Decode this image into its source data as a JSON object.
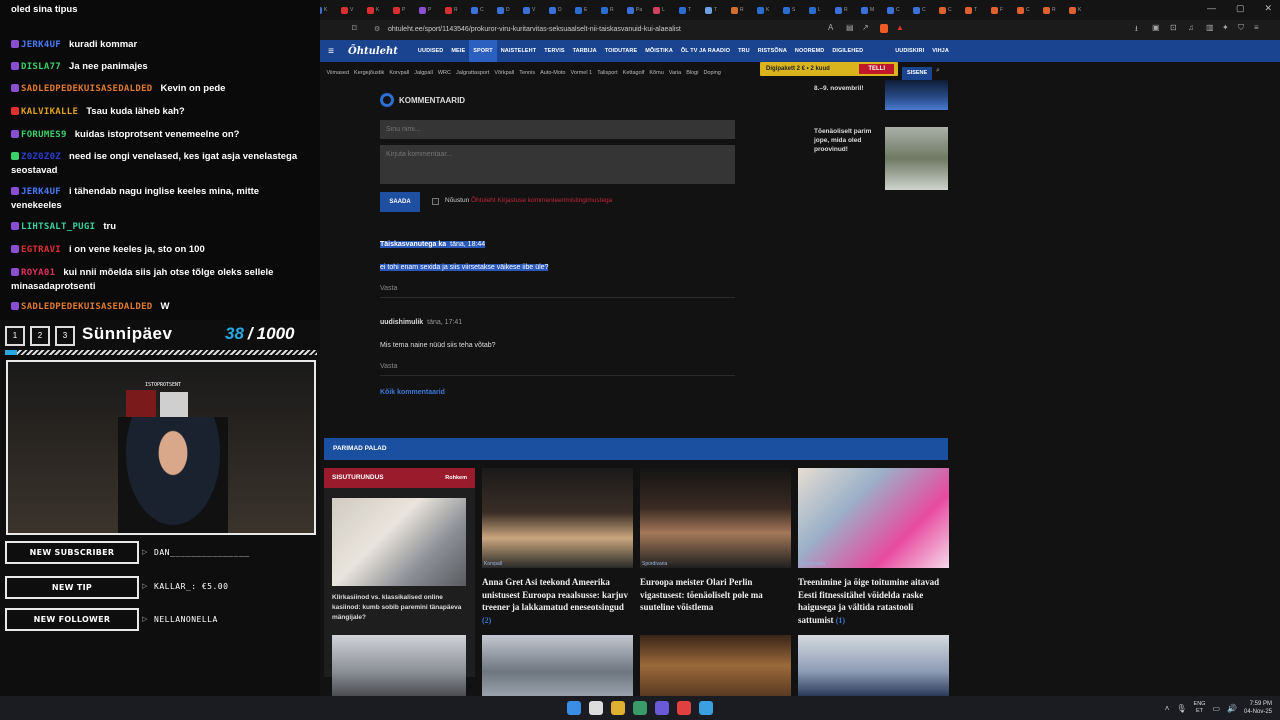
{
  "browser": {
    "tab_favicon_colors": [
      "#8a4fd1",
      "#8a4fd1",
      "#8a4fd1",
      "#7a2fa8",
      "#8a4fd1",
      "#c03030",
      "#3a70d8",
      "#8a4fd1",
      "#8a4fd1",
      "#3a70d8",
      "#e0a020",
      "#c03030",
      "#3a70d8",
      "#d83030",
      "#d83030",
      "#d83030",
      "#8a4fd1",
      "#d83030",
      "#3a70d8",
      "#3a70d8",
      "#3a70d8",
      "#3a70d8",
      "#2a6fd0",
      "#2a6fd0",
      "#3a70d8",
      "#d04060",
      "#2a6fd0",
      "#6fa0e0",
      "#d07030",
      "#2a6fd0",
      "#2a6fd0",
      "#2a6fd0",
      "#3a70d8",
      "#3a70d8",
      "#3a70d8",
      "#3a70d8",
      "#e06030",
      "#e06030",
      "#e06030",
      "#e06030",
      "#e06030",
      "#e06030"
    ],
    "tab_letters": [
      "P",
      "Fa",
      "Fa",
      "Ee",
      "Fa",
      "P",
      "S",
      "R",
      "L",
      "V",
      "E",
      "S",
      "K",
      "V",
      "K",
      "P",
      "P",
      "R",
      "C",
      "D",
      "V",
      "D",
      "E",
      "R",
      "Pa",
      "L",
      "T",
      "T",
      "R",
      "K",
      "S",
      "L",
      "R",
      "M",
      "C",
      "C",
      "C",
      "T",
      "F",
      "C",
      "R",
      "K"
    ],
    "url": "ohtuleht.ee/sport/1143546/prokuror-viru-kuritarvitas-seksuaalselt-nii-taiskasvanuid-kui-alaealist",
    "window_controls": [
      "—",
      "▢",
      "✕"
    ]
  },
  "site": {
    "logo": "Õhtuleht",
    "nav": [
      "UUDISED",
      "MEIE",
      "SPORT",
      "NAISTELEHT",
      "TERVIS",
      "TARBIJA",
      "TOIDUTARE",
      "MÕISTIKA",
      "ÕL TV JA RAADIO",
      "TRU",
      "RISTSÕNA",
      "NOOREMD",
      "DIGILEHED",
      "UUDISKIRI",
      "VIHJA"
    ],
    "active_nav": "SPORT",
    "subnav": [
      "Viimased",
      "Kergejõustik",
      "Korvpall",
      "Jalgpall",
      "WRC",
      "Jalgrattasport",
      "Võrkpall",
      "Tennis",
      "Auto-Moto",
      "Vormel 1",
      "Talisport",
      "Kettagolf",
      "Kõmu",
      "Varia",
      "Blogi",
      "Doping"
    ],
    "promo_text": "Digipakett 2 € • 2 kuud",
    "promo_button": "TELLI",
    "login": "SISENE",
    "comments": {
      "title": "KOMMENTAARID",
      "name_placeholder": "Sinu nimi...",
      "comment_placeholder": "Kirjuta kommentaar...",
      "submit": "SAADA",
      "agree_prefix": "Nõustun ",
      "agree_link": "Õhtuleht Kirjastuse kommenteerimistingimustega",
      "items": [
        {
          "author": "Täiskasvanutega ka",
          "time": "täna, 18:44",
          "body": "ei tohi enam sexida ja siis viirsetakse väikese iibe üle?",
          "reply": "Vasta"
        },
        {
          "author": "uudishimulik",
          "time": "täna, 17:41",
          "body": "Mis tema naine nüüd siis teha võtab?",
          "reply": "Vasta"
        }
      ],
      "all_link": "Kõik kommentaarid"
    },
    "rail": [
      {
        "text": "8.–9. novembril!"
      },
      {
        "text": "Tõenäoliselt parim jope, mida oled proovinud!"
      }
    ],
    "best_title": "PARIMAD PALAD",
    "sisu": {
      "label": "SISUTURUNDUS",
      "more": "Rohkem",
      "title": "Klirkasiinod vs. klassikalised online kasiinod: kumb sobib paremini tänapäeva mängijale?"
    },
    "cards": [
      {
        "category": "Korvpall",
        "title": "Anna Gret Asi teekond Ameerika unistusest Euroopa reaalsusse: karjuv treener ja lakkamatud eneseotsingud",
        "comments": "(2)"
      },
      {
        "category": "Spordivaria",
        "title": "Euroopa meister Olari Perlin vigastusest: tõenäoliselt pole ma suuteline võistlema",
        "comments": ""
      },
      {
        "category": "Spordivaria",
        "title": "Treenimine ja õige toitumine aitavad Eesti fitnessitähel võidelda raske haigusega ja vältida ratastooli sattumist",
        "comments": "(1)"
      }
    ]
  },
  "overlay": {
    "chat": [
      {
        "user": "",
        "msg": "oled sina tipus",
        "color": "#ffffff",
        "badge": ""
      },
      {
        "user": "JERK4UF",
        "msg": "kuradi kommar",
        "color": "#4a7bff",
        "badge": "#8a4fd1"
      },
      {
        "user": "DISLA77",
        "msg": "Ja nee panimajes",
        "color": "#3ad06a",
        "badge": "#8a4fd1"
      },
      {
        "user": "SADLEDPEDEKUISASEDALDED",
        "msg": "Kevin on pede",
        "color": "#e07a30",
        "badge": "#8a4fd1"
      },
      {
        "user": "KALVIKALLE",
        "msg": "Tsau kuda läheb kah?",
        "color": "#e0a020",
        "badge": "#e03030"
      },
      {
        "user": "FORUMES9",
        "msg": "kuidas istoprotsent venemeelne on?",
        "color": "#3ad06a",
        "badge": "#8a4fd1"
      },
      {
        "user": "Z0Z0Z0Z",
        "msg": "need ise ongi venelased, kes igat asja venelastega seostavad",
        "color": "#2a3fd0",
        "badge": "#3ad06a"
      },
      {
        "user": "JERK4UF",
        "msg": "i tähendab nagu inglise keeles mina, mitte venekeeles",
        "color": "#4a7bff",
        "badge": "#8a4fd1"
      },
      {
        "user": "LIHTSALT_PUGI",
        "msg": "tru",
        "color": "#3ad0a0",
        "badge": "#8a4fd1"
      },
      {
        "user": "EGTRAVI",
        "msg": "i on vene keeles ja, sto on 100",
        "color": "#e03030",
        "badge": "#8a4fd1"
      },
      {
        "user": "ROYA01",
        "msg": "kui nnii mõelda siis jah otse tõlge oleks sellele minasadaprotsenti",
        "color": "#e03060",
        "badge": "#8a4fd1"
      },
      {
        "user": "SADLEDPEDEKUISASEDALDED",
        "msg": "W",
        "color": "#e07a30",
        "badge": "#8a4fd1"
      }
    ],
    "goal": {
      "boxes": [
        "1",
        "2",
        "3"
      ],
      "title": "Sünnipäev",
      "current": "38",
      "max": "1000",
      "progress": 0.038
    },
    "cam_sign": "ISTOPROTSENT",
    "alerts": [
      {
        "label": "NEW SUBSCRIBER",
        "value": "DAN_______________"
      },
      {
        "label": "NEW TIP",
        "value": "KALLAR_: €5.00"
      },
      {
        "label": "NEW FOLLOWER",
        "value": "NELLANONELLA"
      }
    ]
  },
  "taskbar": {
    "icons": [
      "#3a8ee6",
      "#dddddd",
      "#e0b030",
      "#3a9a6a",
      "#6a5ad8",
      "#e04040",
      "#3aa0e0"
    ],
    "lang": [
      "ENG",
      "ET"
    ],
    "time": "7:59 PM",
    "date": "04-Nov-25"
  }
}
